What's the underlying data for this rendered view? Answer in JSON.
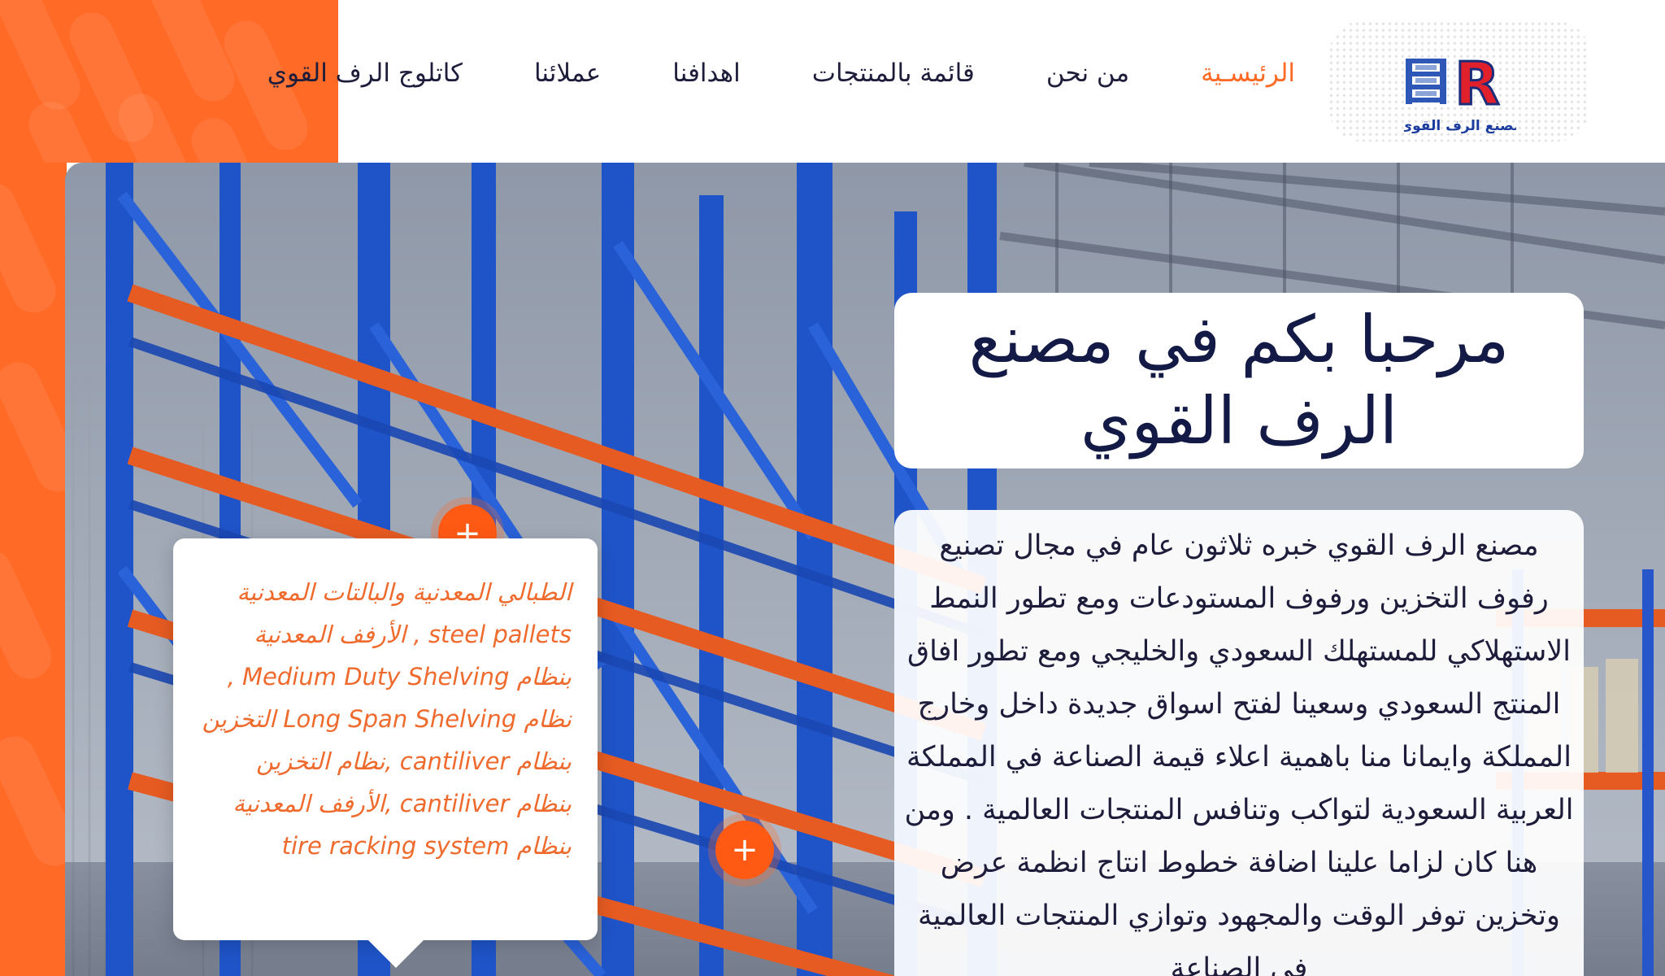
{
  "header": {
    "nav": [
      {
        "label": "الرئيسـية",
        "active": true
      },
      {
        "label": "من نحن",
        "active": false
      },
      {
        "label": "قائمة بالمنتجات",
        "active": false
      },
      {
        "label": "اهدافنا",
        "active": false
      },
      {
        "label": "عملائنا",
        "active": false
      },
      {
        "label": "كاتلوج الرف القوي",
        "active": false
      }
    ],
    "logo": {
      "letter": "R",
      "text": "مصنع الرف القوى"
    }
  },
  "hero": {
    "title": "مرحبا بكم في مصنع الرف القوي",
    "description": "مصنع الرف القوي خبره ثلاثون عام في مجال تصنيع رفوف التخزين ورفوف المستودعات ومع تطور النمط الاستهلاكي للمستهلك السعودي والخليجي ومع تطور افاق المنتج السعودي وسعينا لفتح اسواق جديدة داخل وخارج المملكة وايمانا منا باهمية اعلاء قيمة الصناعة في المملكة العربية السعودية لتواكب وتنافس المنتجات العالمية . ومن هنا كان لزاما علينا اضافة خطوط انتاج انظمة عرض وتخزين توفر الوقت والمجهود وتوازي المنتجات العالمية في الصناعة",
    "hotspot_symbol": "+",
    "tooltip": "الطبالي المعدنية والبالتات المعدنية steel pallets , الأرفف المعدنية بنظام Medium Duty Shelving , نظام Long Span Shelving التخزين بنظام cantiliver ,نظام التخزين بنظام cantiliver ,الأرفف المعدنية بنظام tire racking system"
  },
  "colors": {
    "accent": "#ff6a26",
    "navy": "#131a45",
    "rack_blue": "#1c4fc4",
    "rack_orange": "#e9571f"
  }
}
